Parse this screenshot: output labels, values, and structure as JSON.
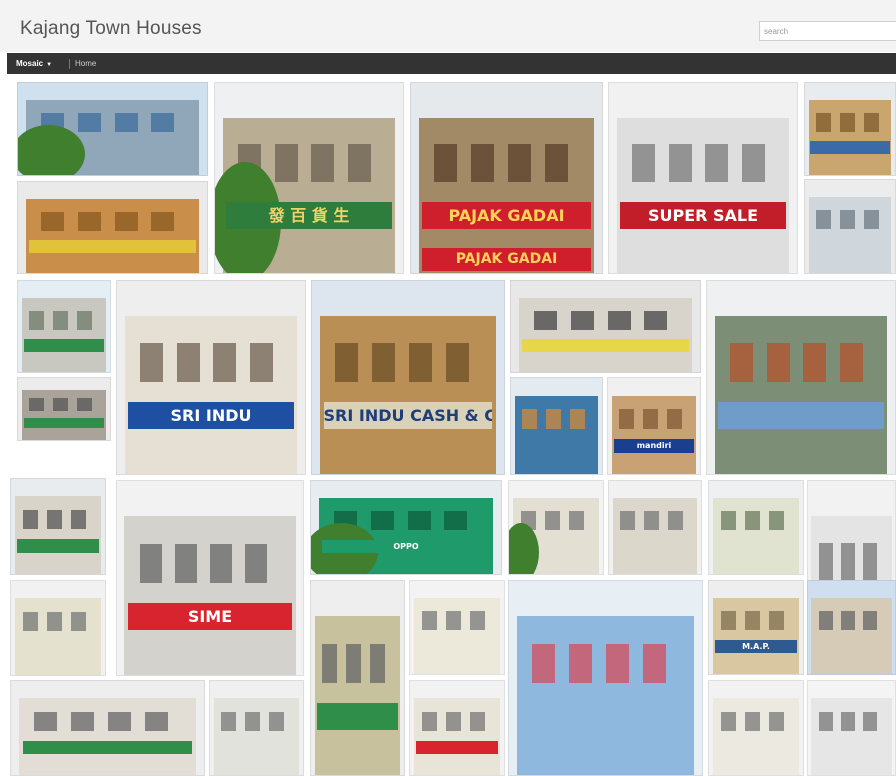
{
  "site": {
    "title": "Kajang Town Houses"
  },
  "search": {
    "placeholder": "search"
  },
  "nav": {
    "mosaic_label": "Mosaic",
    "home_label": "Home"
  },
  "tiles": [
    {
      "name": "photo-tile",
      "sky": "#cfe0ee",
      "facade": "#8fa7b9",
      "trim": "#3f6e9e",
      "tree": true
    },
    {
      "name": "photo-tile",
      "sky": "#eef0f1",
      "facade": "#b9ad93",
      "trim": "#6b6250",
      "sign": "發 百 貨 生",
      "sign_bg": "#2e7d3c",
      "sign_fg": "#f0d36a",
      "tree": true
    },
    {
      "name": "photo-tile",
      "sky": "#e6e9ec",
      "facade": "#a38a66",
      "trim": "#5a3f2a",
      "sign": "PAJAK GADAI",
      "sign_bg": "#d01f2c",
      "sign_fg": "#ffd35a",
      "sign2": "PAJAK GADAI"
    },
    {
      "name": "photo-tile",
      "sky": "#f1f1f1",
      "facade": "#dedede",
      "trim": "#7a7a7a",
      "sign": "SUPER SALE",
      "sign_bg": "#c21e2a",
      "sign_fg": "#ffffff"
    },
    {
      "name": "photo-tile",
      "sky": "#e9ecee",
      "facade": "#c9a66e",
      "trim": "#7d5a2e",
      "sign": "",
      "sign_bg": "#3b6aa8",
      "sign_fg": "#ffffff"
    },
    {
      "name": "photo-tile",
      "sky": "#eaeaea",
      "facade": "#c98e4a",
      "trim": "#8a5a22",
      "sign": "",
      "sign_bg": "#e2c23b",
      "sign_fg": "#333333"
    },
    {
      "name": "photo-tile",
      "sky": "#ececec",
      "facade": "#cfd6dc",
      "trim": "#6f7a84"
    },
    {
      "name": "photo-tile",
      "sky": "#e5eef5",
      "facade": "#c8c8c0",
      "trim": "#6c7b6a",
      "sign": "",
      "sign_bg": "#2f8f4a",
      "sign_fg": "#ffffff"
    },
    {
      "name": "photo-tile",
      "sky": "#eeeeee",
      "facade": "#e6e0d4",
      "trim": "#6d6252",
      "sign": "SRI INDU",
      "sign_bg": "#1f4fa3",
      "sign_fg": "#ffffff"
    },
    {
      "name": "photo-tile",
      "sky": "#dde6ee",
      "facade": "#b98f56",
      "trim": "#6e4f28",
      "sign": "SRI INDU CASH & CARRY",
      "sign_bg": "#d9d2b8",
      "sign_fg": "#1d3e7a"
    },
    {
      "name": "photo-tile",
      "sky": "#e8e8e8",
      "facade": "#d8d4cc",
      "trim": "#444444",
      "sign": "",
      "sign_bg": "#e6d74a",
      "sign_fg": "#333333"
    },
    {
      "name": "photo-tile",
      "sky": "#eef0f2",
      "facade": "#7c8f76",
      "trim": "#b4522e",
      "sign": "",
      "sign_bg": "#6f9cc8",
      "sign_fg": "#ffffff"
    },
    {
      "name": "photo-tile",
      "sky": "#ececec",
      "facade": "#a9a39a",
      "trim": "#555555",
      "sign": "",
      "sign_bg": "#2f8f4a",
      "sign_fg": "#ffffff"
    },
    {
      "name": "photo-tile",
      "sky": "#e4ebf0",
      "facade": "#3f79a8",
      "trim": "#d08a3a"
    },
    {
      "name": "photo-tile",
      "sky": "#f0f0f0",
      "facade": "#c8a275",
      "trim": "#7f5a35",
      "sign": "mandiri",
      "sign_bg": "#1b3f8f",
      "sign_fg": "#ffffff"
    },
    {
      "name": "photo-tile",
      "sky": "#e9ecef",
      "facade": "#d9d4c9",
      "trim": "#555555",
      "sign": "",
      "sign_bg": "#2f8f4a",
      "sign_fg": "#ffffff"
    },
    {
      "name": "photo-tile",
      "sky": "#f2f2f2",
      "facade": "#d4d2cd",
      "trim": "#666666",
      "sign": "SIME",
      "sign_bg": "#d8242f",
      "sign_fg": "#ffffff"
    },
    {
      "name": "photo-tile",
      "sky": "#e6ecef",
      "facade": "#1f9a6a",
      "trim": "#0f5e3f",
      "sign": "OPPO",
      "sign_bg": "#1f9a6a",
      "sign_fg": "#ffffff",
      "tree": true
    },
    {
      "name": "photo-tile",
      "sky": "#f3f3f3",
      "facade": "#e3dfd3",
      "trim": "#777777",
      "tree": true
    },
    {
      "name": "photo-tile",
      "sky": "#f1f1f1",
      "facade": "#dcd7cb",
      "trim": "#777777"
    },
    {
      "name": "photo-tile",
      "sky": "#eef0f1",
      "facade": "#dfe3cf",
      "trim": "#6b7b5f"
    },
    {
      "name": "photo-tile",
      "sky": "#f2f2f2",
      "facade": "#e4e4e4",
      "trim": "#777777",
      "sign": "",
      "sign_bg": "#c22",
      "sign_fg": "#ffffff"
    },
    {
      "name": "photo-tile",
      "sky": "#f1f1f1",
      "facade": "#e4e1cf",
      "trim": "#777777"
    },
    {
      "name": "photo-tile",
      "sky": "#eeeeee",
      "facade": "#c8c19d",
      "trim": "#666666",
      "sign": "",
      "sign_bg": "#2f8f4a",
      "sign_fg": "#ffffff"
    },
    {
      "name": "photo-tile",
      "sky": "#f3f3f3",
      "facade": "#ece9da",
      "trim": "#777777"
    },
    {
      "name": "photo-tile",
      "sky": "#e7eef4",
      "facade": "#8fb8de",
      "trim": "#d44c5c"
    },
    {
      "name": "photo-tile",
      "sky": "#eeeeee",
      "facade": "#d8c7a0",
      "trim": "#7f6f4f",
      "sign": "M.A.P.",
      "sign_bg": "#2f5a8f",
      "sign_fg": "#ffffff"
    },
    {
      "name": "photo-tile",
      "sky": "#cfdff0",
      "facade": "#d6cbb6",
      "trim": "#666666"
    },
    {
      "name": "photo-tile",
      "sky": "#eeeeee",
      "facade": "#e2ded5",
      "trim": "#666666",
      "sign": "",
      "sign_bg": "#2f8f4a",
      "sign_fg": "#ffffff"
    },
    {
      "name": "photo-tile",
      "sky": "#f0f0f0",
      "facade": "#e2e2dc",
      "trim": "#777777"
    },
    {
      "name": "photo-tile",
      "sky": "#f2f2f2",
      "facade": "#e8e4d8",
      "trim": "#777777",
      "sign": "",
      "sign_bg": "#d8242f",
      "sign_fg": "#ffffff"
    },
    {
      "name": "photo-tile",
      "sky": "#f2f2f2",
      "facade": "#eceae0",
      "trim": "#777777"
    },
    {
      "name": "photo-tile",
      "sky": "#f4f4f4",
      "facade": "#e6e6e6",
      "trim": "#777777"
    },
    {
      "name": "photo-tile",
      "sky": "#f1f1f1",
      "facade": "#e2ddd2",
      "trim": "#777777",
      "sign": "",
      "sign_bg": "#2f6fb8",
      "sign_fg": "#ffffff"
    }
  ]
}
